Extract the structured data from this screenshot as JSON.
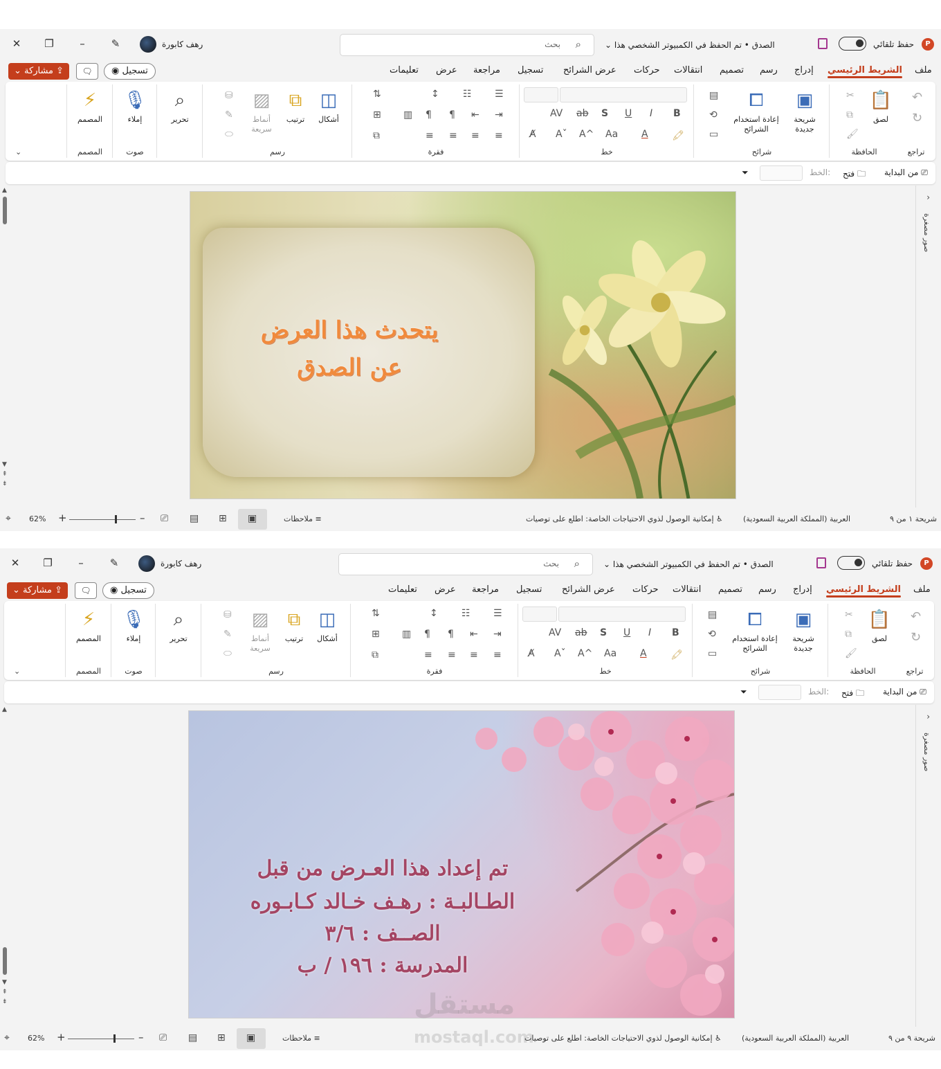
{
  "colors": {
    "accent": "#c43e1c",
    "brand": "#d24726",
    "slide1_text": "#f08a3c",
    "slide2_text": "#a44563"
  },
  "titlebar": {
    "autosave_label": "حفظ تلقائي",
    "doc_title": "الصدق • تم الحفظ في الكمبيوتر الشخصي هذا",
    "search_placeholder": "بحث",
    "user_name": "رهف كابورة"
  },
  "tabs": [
    "ملف",
    "الشريط الرئيسي",
    "إدراج",
    "رسم",
    "تصميم",
    "انتقالات",
    "حركات",
    "عرض الشرائح",
    "تسجيل",
    "مراجعة",
    "عرض",
    "تعليمات"
  ],
  "actions": {
    "record_label": "تسجيل",
    "share_label": "مشاركة"
  },
  "ribbon": {
    "groups": {
      "undo": "تراجع",
      "clipboard": "الحافظة",
      "slides": "شرائح",
      "font": "خط",
      "paragraph": "فقرة",
      "drawing": "رسم",
      "voice": "صوت",
      "designer": "المصمم"
    },
    "buttons": {
      "paste": "لصق",
      "new_slide_1": "شريحة",
      "new_slide_2": "جديدة",
      "reuse_1": "إعادة استخدام",
      "reuse_2": "الشرائح",
      "shapes": "أشكال",
      "arrange": "ترتيب",
      "quick_styles_1": "أنماط",
      "quick_styles_2": "سريعة",
      "editing": "تحرير",
      "dictate": "إملاء",
      "designer": "المصمم"
    },
    "font_buttons": {
      "bold": "B",
      "italic": "I",
      "underline": "U",
      "shadow": "S",
      "strike": "ab",
      "spacing": "AV",
      "case": "Aa"
    }
  },
  "slideshow_bar": {
    "from_beginning": "من البداية",
    "open": "فتح",
    "font_label": "الخط:"
  },
  "side_panel": {
    "label": "صور مصغرة"
  },
  "windows": [
    {
      "slide_lines": [
        "يتحدث هذا العرض",
        "عن الصدق"
      ],
      "status": {
        "slide_counter": "شريحة ١ من ٩",
        "language": "العربية (المملكة العربية السعودية)",
        "accessibility": "إمكانية الوصول لذوي الاحتياجات الخاصة: اطلع على توصيات",
        "notes": "ملاحظات",
        "zoom": "62%"
      }
    },
    {
      "slide_lines": [
        "تم إعداد هذا العـرض من قبل",
        "الطـالبـة : رهـف خـالد كـابـوره",
        "الصــف : ٣/٦",
        "المدرسة : ١٩٦ / ب"
      ],
      "status": {
        "slide_counter": "شريحة ٩ من ٩",
        "language": "العربية (المملكة العربية السعودية)",
        "accessibility": "إمكانية الوصول لذوي الاحتياجات الخاصة: اطلع على توصيات",
        "notes": "ملاحظات",
        "zoom": "62%"
      }
    }
  ],
  "watermark": {
    "arabic": "مستقل",
    "latin": "mostaql.com"
  }
}
